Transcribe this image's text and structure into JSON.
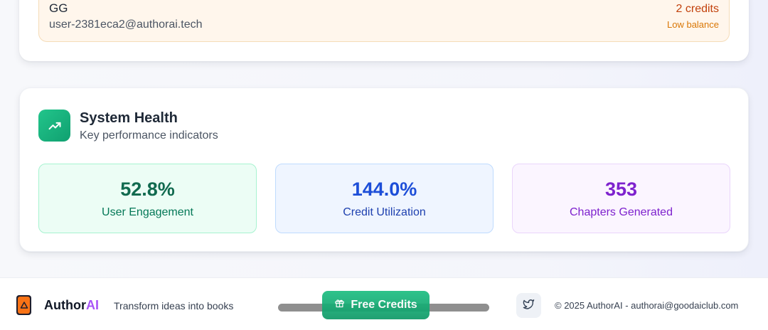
{
  "account": {
    "name": "GG",
    "email": "user-2381eca2@authorai.tech",
    "credits": "2 credits",
    "credit_status": "Low balance"
  },
  "system_health": {
    "title": "System Health",
    "subtitle": "Key performance indicators",
    "icon": "trending-up-icon",
    "stats": [
      {
        "value": "52.8%",
        "label": "User Engagement",
        "color": "#116a4f"
      },
      {
        "value": "144.0%",
        "label": "Credit Utilization",
        "color": "#1d4ed8"
      },
      {
        "value": "353",
        "label": "Chapters Generated",
        "color": "#7e22ce"
      }
    ]
  },
  "footer": {
    "brand_main": "Author",
    "brand_accent": "AI",
    "tagline": "Transform ideas into books",
    "free_credits_label": "Free Credits",
    "copyright": "© 2025 AuthorAI - authorai@goodaiclub.com"
  },
  "colors": {
    "accent_green": "#10a070",
    "warning": "#c2410c",
    "brand_purple": "#a855f7"
  }
}
